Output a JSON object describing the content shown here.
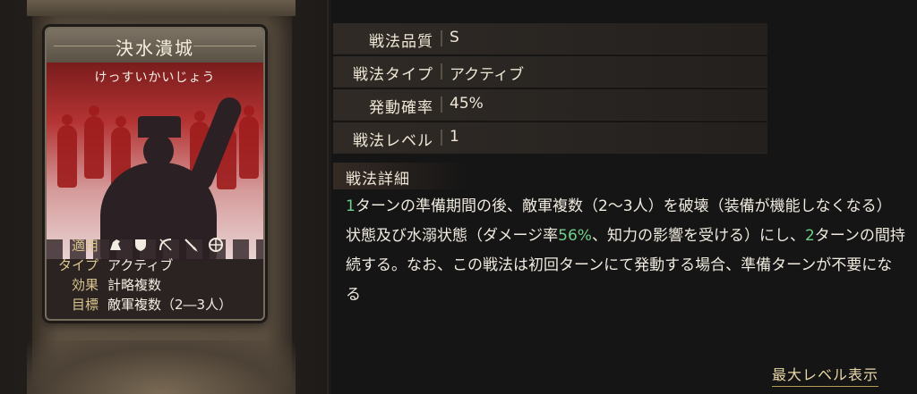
{
  "card": {
    "title": "決水潰城",
    "reading": "けっすいかいじょう",
    "rows": [
      {
        "label": "適用",
        "icons": [
          "cavalry-icon",
          "shield-icon",
          "bow-icon",
          "spear-icon",
          "wheel-icon"
        ]
      },
      {
        "label": "タイプ",
        "value": "アクティブ"
      },
      {
        "label": "効果",
        "value": "計略複数"
      },
      {
        "label": "目標",
        "value": "敵軍複数（2―3人）"
      }
    ]
  },
  "stats": [
    {
      "label": "戦法品質",
      "value": "S"
    },
    {
      "label": "戦法タイプ",
      "value": "アクティブ"
    },
    {
      "label": "発動確率",
      "value": "45%"
    },
    {
      "label": "戦法レベル",
      "value": "1"
    }
  ],
  "detail": {
    "title": "戦法詳細",
    "segments": [
      {
        "text": "1",
        "hl": true
      },
      {
        "text": "ターンの準備期間の後、敵軍複数（2〜3人）を破壊（装備が機能しなくなる）状態及び水溺状態（ダメージ率",
        "hl": false
      },
      {
        "text": "56%",
        "hl": true
      },
      {
        "text": "、知力の影響を受ける）にし、",
        "hl": false
      },
      {
        "text": "2",
        "hl": true
      },
      {
        "text": "ターンの間持続する。なお、この戦法は初回ターンにて発動する場合、準備ターンが不要になる",
        "hl": false
      }
    ]
  },
  "max_level_button": "最大レベル表示",
  "colors": {
    "highlight": "#6fd08b",
    "label_gold": "#d9c48e",
    "art_red": "#b43333"
  }
}
